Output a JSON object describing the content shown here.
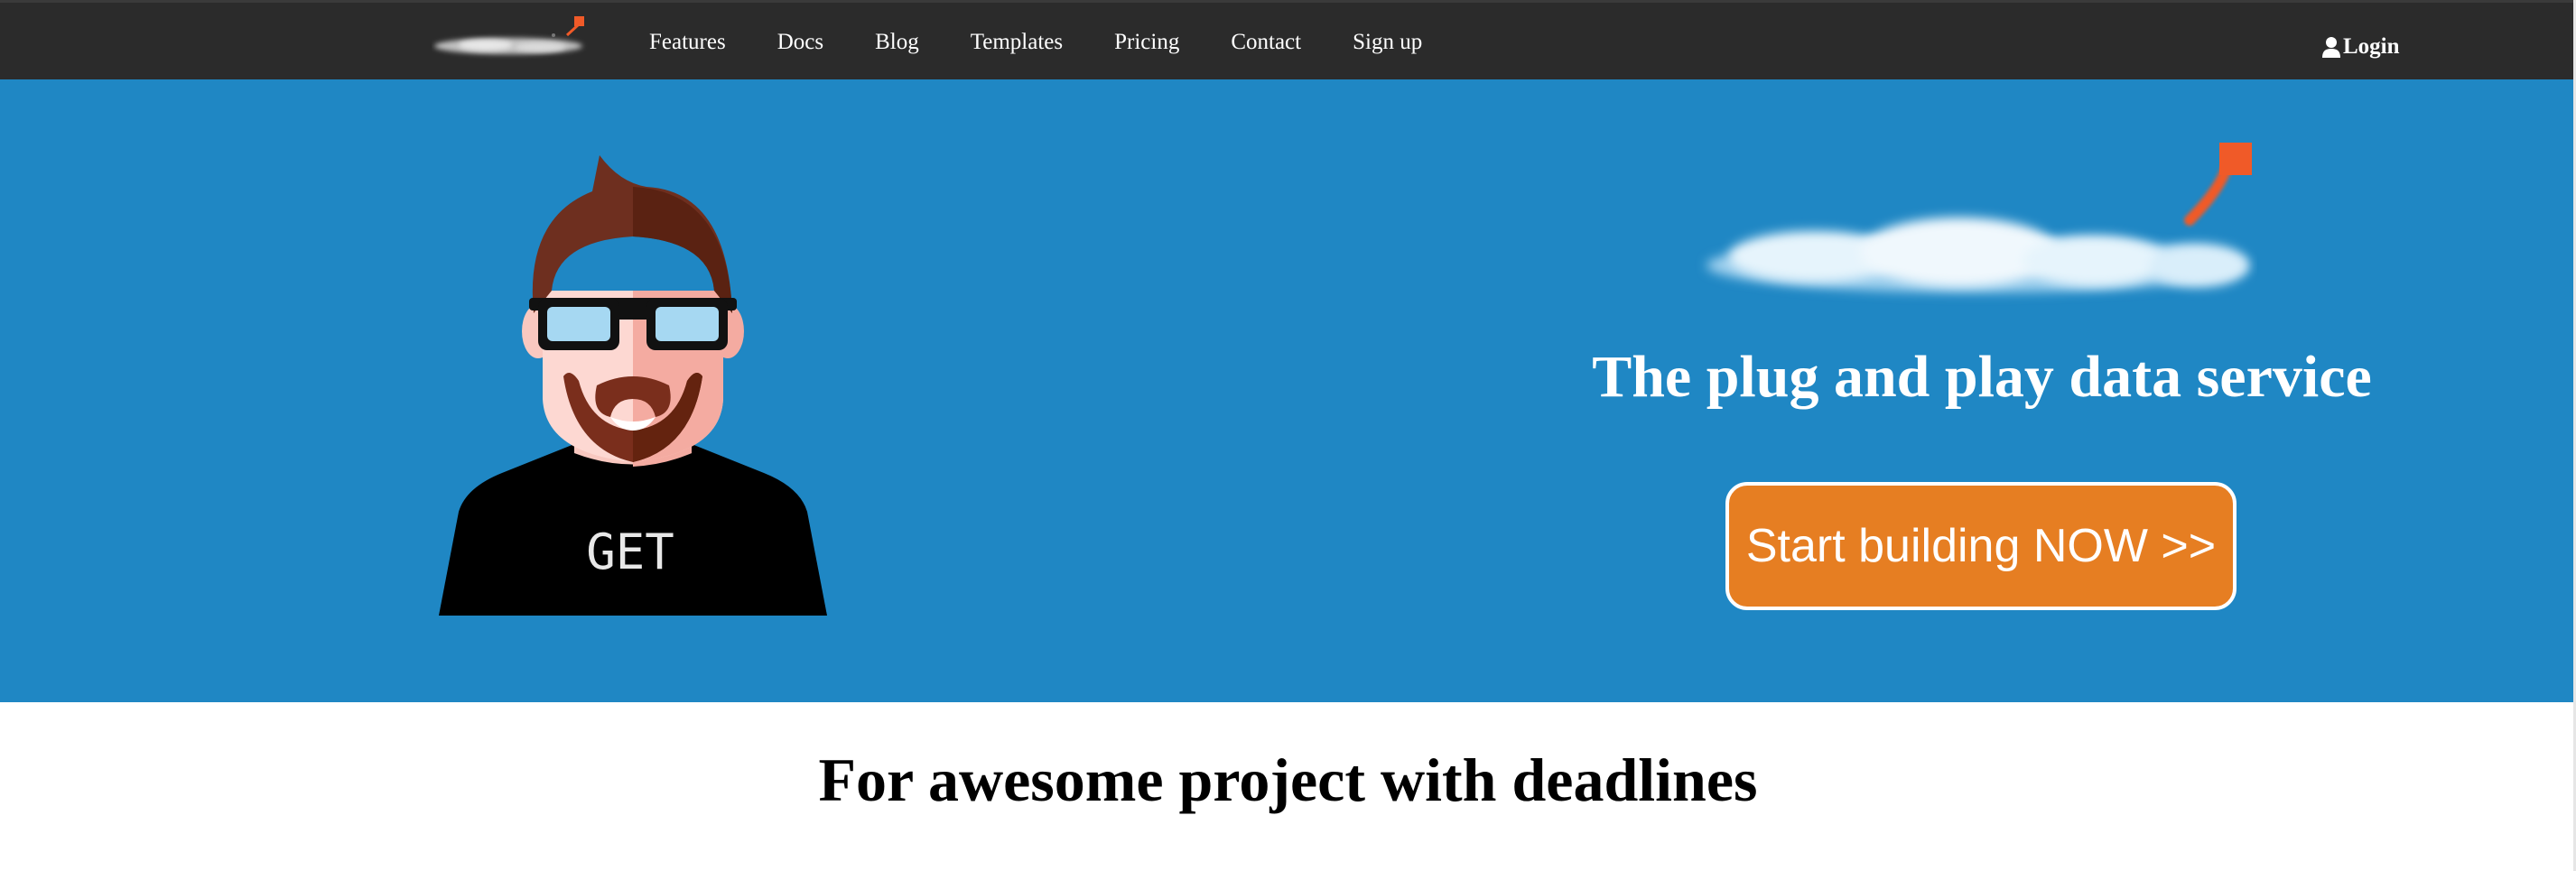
{
  "nav": {
    "links": [
      "Features",
      "Docs",
      "Blog",
      "Templates",
      "Pricing",
      "Contact",
      "Sign up"
    ],
    "login_label": "Login",
    "logo_icon": "cloud-logo-icon",
    "user_icon": "user-icon"
  },
  "hero": {
    "avatar_shirt_text": "GET",
    "tagline": "The plug and play data service",
    "cta_label": "Start building NOW >>",
    "logo_icon": "cloud-logo-icon"
  },
  "section": {
    "title": "For awesome project with deadlines"
  },
  "colors": {
    "navbar": "#2b2b2b",
    "hero_background": "#1f87c4",
    "cta_background": "#e67e22",
    "accent_flag": "#f05a28"
  }
}
